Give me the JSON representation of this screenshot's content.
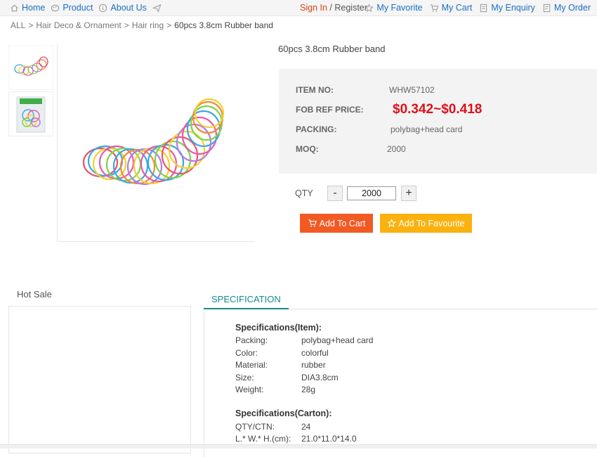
{
  "topnav": [
    {
      "label": "Home",
      "icon": "home-icon"
    },
    {
      "label": "Product",
      "icon": "palette-icon"
    },
    {
      "label": "About Us",
      "icon": "info-icon"
    }
  ],
  "signin": {
    "sign_in": "Sign In",
    "separator": "/",
    "register": "Register"
  },
  "rightnav": [
    {
      "label": "My Favorite",
      "icon": "star-icon"
    },
    {
      "label": "My Cart",
      "icon": "cart-icon"
    },
    {
      "label": "My Enquiry",
      "icon": "enquiry-icon"
    },
    {
      "label": "My Order",
      "icon": "order-icon"
    }
  ],
  "breadcrumb": {
    "all": "ALL",
    "sep": ">",
    "cat1": "Hair Deco & Ornament",
    "cat2": "Hair ring",
    "current": "60pcs 3.8cm Rubber band"
  },
  "product": {
    "title": "60pcs 3.8cm Rubber band",
    "item_no_label": "ITEM NO:",
    "item_no": "WHW57102",
    "price_label": "FOB REF PRICE:",
    "price": "$0.342~$0.418",
    "packing_label": "PACKING:",
    "packing": "polybag+head card",
    "moq_label": "MOQ:",
    "moq": "2000"
  },
  "qty": {
    "label": "QTY",
    "minus": "-",
    "plus": "+",
    "value": "2000"
  },
  "buttons": {
    "add_cart": "Add To Cart",
    "add_fav": "Add To Favourite"
  },
  "hot_sale": "Hot Sale",
  "spec_tab": "SPECIFICATION",
  "spec_item": {
    "title": "Specifications(Item):",
    "rows": [
      {
        "k": "Packing:",
        "v": "polybag+head card"
      },
      {
        "k": "Color:",
        "v": "colorful"
      },
      {
        "k": "Material:",
        "v": "rubber"
      },
      {
        "k": "Size:",
        "v": "DIA3.8cm"
      },
      {
        "k": "Weight:",
        "v": "28g"
      }
    ]
  },
  "spec_carton": {
    "title": "Specifications(Carton):",
    "rows": [
      {
        "k": "QTY/CTN:",
        "v": "24"
      },
      {
        "k": "L.* W.* H.(cm):",
        "v": "21.0*11.0*14.0"
      }
    ]
  },
  "colors": {
    "link": "#1a6ec4",
    "price": "#e0101a",
    "cart_btn": "#f25a24",
    "fav_btn": "#fbb20e",
    "tab": "#148c8c"
  }
}
